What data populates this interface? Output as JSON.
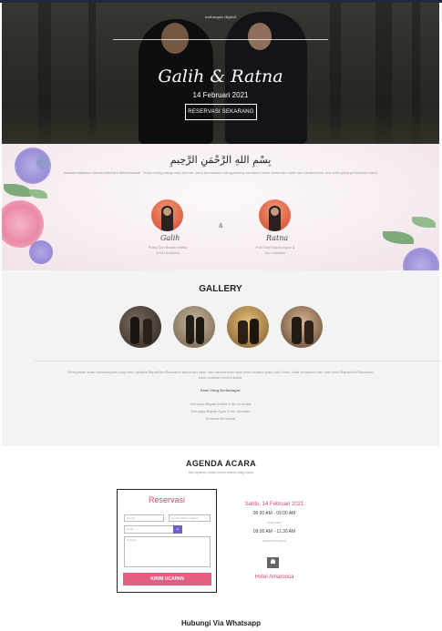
{
  "hero": {
    "logo_text": "undangan digital",
    "names": "Galih & Ratna",
    "date": "14 Februari 2021",
    "reservation_button": "RESERVASI SEKARANG"
  },
  "couple": {
    "bismillah": "بِسْمِ اللهِ الرَّحْمَنِ الرَّحِيمِ",
    "intro": "Assalamualaikum Warahmatullahi Wabarakatuh. Tanpa mengurangi rasa hormat, kami bermaksud mengundang saudara/i untuk berkenan hadir dan memberikan doa restu pada pernikahan kami.",
    "amp": "&",
    "groom": {
      "name": "Galih",
      "parents_line1": "Putra Dari Bapak Ardilla",
      "parents_line2": "& Ibu Kusuma"
    },
    "bride": {
      "name": "Ratna",
      "parents_line1": "Putri Dari Bapak Agus &",
      "parents_line2": "Ibu Ulandari"
    }
  },
  "gallery": {
    "title": "GALLERY",
    "closing_line1": "Merupakan suatu kebahagiaan bagi kami apabila Bapak/Ibu/Saudara/i berkenan hadir dan memberikan doa restu kepada putra putri kami. Atas kehadiran dan doa restu Bapak/Ibu/Saudara/i",
    "closing_line2": "kami ucapkan terima kasih.",
    "turut_title": "Kami Yang Berbahagia:",
    "guests": [
      "Keluarga Bapak Ardilla & Ibu Kusuma",
      "Keluarga Bapak Agus & Ibu Ulandari",
      "Kerabat Mempelai"
    ]
  },
  "agenda": {
    "title": "AGENDA ACARA",
    "subtitle": "Merupakan suatu kehormatan bagi kami"
  },
  "rsvp": {
    "title": "Reservasi",
    "name_placeholder": "Nama*",
    "count_placeholder": "Jumlah Tamu / Hadir?",
    "attend_value": "Hadir",
    "message_placeholder": "Ucapan",
    "submit_label": "KIRIM UCAPAN"
  },
  "event": {
    "date": "Sabtu, 14 Februari 2021",
    "akad_time": "08.00 AM - 09.00 AM",
    "akad_label": "Akad Nikah",
    "resepsi_time": "09.00 AM - 11.30 AM",
    "resepsi_label": "Resepsi Pernikahan",
    "venue": "Hotel Amaroosa"
  },
  "whatsapp": {
    "title": "Hubungi Via Whatsapp"
  },
  "colors": {
    "accent_pink": "#e45e84",
    "title_pink": "#d9456b",
    "chevron_purple": "#6b62c9"
  }
}
